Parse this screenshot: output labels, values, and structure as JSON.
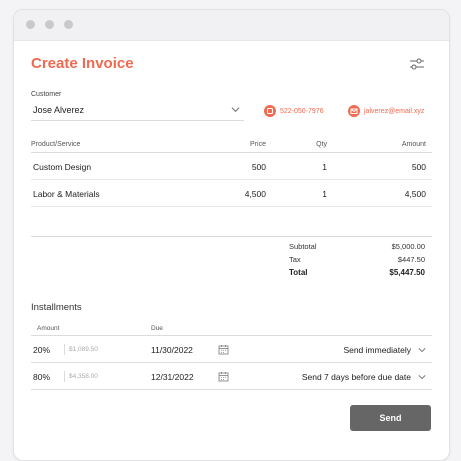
{
  "header": {
    "title": "Create Invoice"
  },
  "customer": {
    "label": "Customer",
    "value": "Jose Alverez",
    "phone": "522-050-7976",
    "email": "jalverez@email.xyz"
  },
  "items": {
    "columns": {
      "product": "Product/Service",
      "price": "Price",
      "qty": "Qty",
      "amount": "Amount"
    },
    "rows": [
      {
        "product": "Custom Design",
        "price": "500",
        "qty": "1",
        "amount": "500"
      },
      {
        "product": "Labor & Materials",
        "price": "4,500",
        "qty": "1",
        "amount": "4,500"
      }
    ]
  },
  "totals": {
    "subtotal_label": "Subtotal",
    "subtotal": "$5,000.00",
    "tax_label": "Tax",
    "tax": "$447.50",
    "total_label": "Total",
    "total": "$5,447.50"
  },
  "installments": {
    "title": "Installments",
    "columns": {
      "amount": "Amount",
      "due": "Due"
    },
    "rows": [
      {
        "percent": "20%",
        "amount": "$1,089.50",
        "due": "11/30/2022",
        "send": "Send immediately"
      },
      {
        "percent": "80%",
        "amount": "$4,358.00",
        "due": "12/31/2022",
        "send": "Send 7 days before due date"
      }
    ]
  },
  "actions": {
    "send_label": "Send"
  },
  "colors": {
    "accent": "#ee6a50",
    "button": "#666666"
  }
}
